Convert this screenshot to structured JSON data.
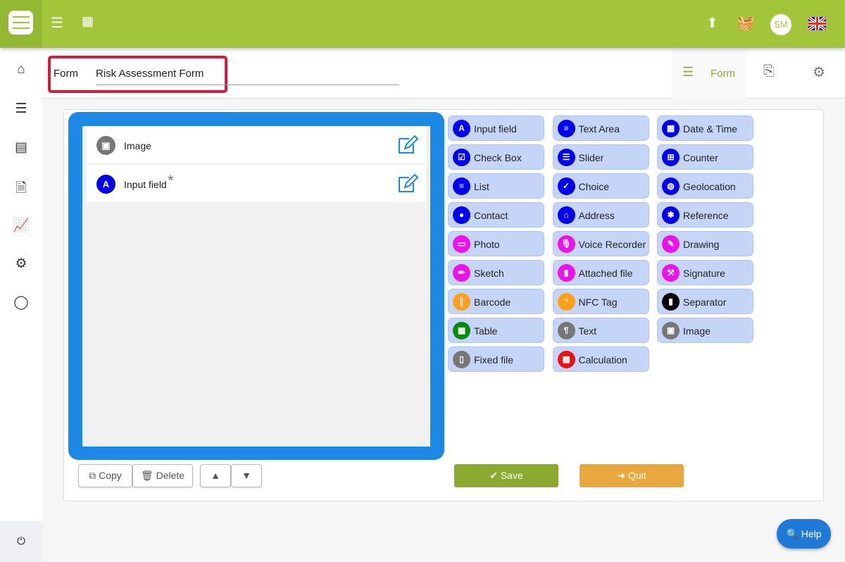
{
  "header": {
    "avatar_initials": "SM",
    "colors": {
      "brand": "#a2c53a"
    }
  },
  "subheader": {
    "form_label": "Form",
    "form_name": "Risk Assessment Form",
    "tab_form": "Form"
  },
  "form_items": [
    {
      "label": "Image",
      "icon": "image-icon",
      "color": "#777777",
      "glyph": "▣",
      "required": false
    },
    {
      "label": "Input field",
      "icon": "letter-a-icon",
      "color": "#0000ee",
      "glyph": "A",
      "required": true,
      "required_mark": "*"
    }
  ],
  "palette": [
    [
      {
        "label": "Input field",
        "icon": "letter-a-icon",
        "color": "#0000ee",
        "glyph": "A"
      },
      {
        "label": "Text Area",
        "icon": "align-left-icon",
        "color": "#0000ee",
        "glyph": "≡"
      },
      {
        "label": "Date & Time",
        "icon": "calendar-icon",
        "color": "#0000ee",
        "glyph": "▦"
      }
    ],
    [
      {
        "label": "Check Box",
        "icon": "checkbox-icon",
        "color": "#0000ee",
        "glyph": "☑"
      },
      {
        "label": "Slider",
        "icon": "sliders-icon",
        "color": "#0000ee",
        "glyph": "☰"
      },
      {
        "label": "Counter",
        "icon": "plus-square-icon",
        "color": "#0000ee",
        "glyph": "⊞"
      }
    ],
    [
      {
        "label": "List",
        "icon": "list-icon",
        "color": "#0000ee",
        "glyph": "≡"
      },
      {
        "label": "Choice",
        "icon": "check-circle-icon",
        "color": "#0000ee",
        "glyph": "✓"
      },
      {
        "label": "Geolocation",
        "icon": "globe-icon",
        "color": "#0000ee",
        "glyph": "◍"
      }
    ],
    [
      {
        "label": "Contact",
        "icon": "user-icon",
        "color": "#0000ee",
        "glyph": "●"
      },
      {
        "label": "Address",
        "icon": "home-icon",
        "color": "#0000ee",
        "glyph": "⌂"
      },
      {
        "label": "Reference",
        "icon": "asterisk-icon",
        "color": "#0000ee",
        "glyph": "✱"
      }
    ],
    [
      {
        "label": "Photo",
        "icon": "photo-icon",
        "color": "#ee11ee",
        "glyph": "▭"
      },
      {
        "label": "Voice Recorder",
        "icon": "microphone-icon",
        "color": "#ee11ee",
        "glyph": "🎙"
      },
      {
        "label": "Drawing",
        "icon": "brush-icon",
        "color": "#ee11ee",
        "glyph": "✎"
      }
    ],
    [
      {
        "label": "Sketch",
        "icon": "pencil-icon",
        "color": "#ee11ee",
        "glyph": "✏"
      },
      {
        "label": "Attached file",
        "icon": "file-icon",
        "color": "#ee11ee",
        "glyph": "▮"
      },
      {
        "label": "Signature",
        "icon": "gavel-icon",
        "color": "#ee11ee",
        "glyph": "⚒"
      }
    ],
    [
      {
        "label": "Barcode",
        "icon": "barcode-icon",
        "color": "#ff9f1a",
        "glyph": "║"
      },
      {
        "label": "NFC Tag",
        "icon": "rss-icon",
        "color": "#ff9f1a",
        "glyph": "◝"
      },
      {
        "label": "Separator",
        "icon": "bookmark-icon",
        "color": "#000000",
        "glyph": "▮"
      }
    ],
    [
      {
        "label": "Table",
        "icon": "table-icon",
        "color": "#0a8a0a",
        "glyph": "▦"
      },
      {
        "label": "Text",
        "icon": "paragraph-icon",
        "color": "#777777",
        "glyph": "¶"
      },
      {
        "label": "Image",
        "icon": "image-icon",
        "color": "#777777",
        "glyph": "▣"
      }
    ],
    [
      {
        "label": "Fixed file",
        "icon": "file-outline-icon",
        "color": "#777777",
        "glyph": "▯"
      },
      {
        "label": "Calculation",
        "icon": "calculator-icon",
        "color": "#ee1111",
        "glyph": "▦"
      }
    ]
  ],
  "toolbar": {
    "copy": "Copy",
    "delete": "Delete",
    "save": "Save",
    "quit": "Quit",
    "save_color": "#8aab2f",
    "quit_color": "#e8a83e"
  },
  "help": "Help"
}
